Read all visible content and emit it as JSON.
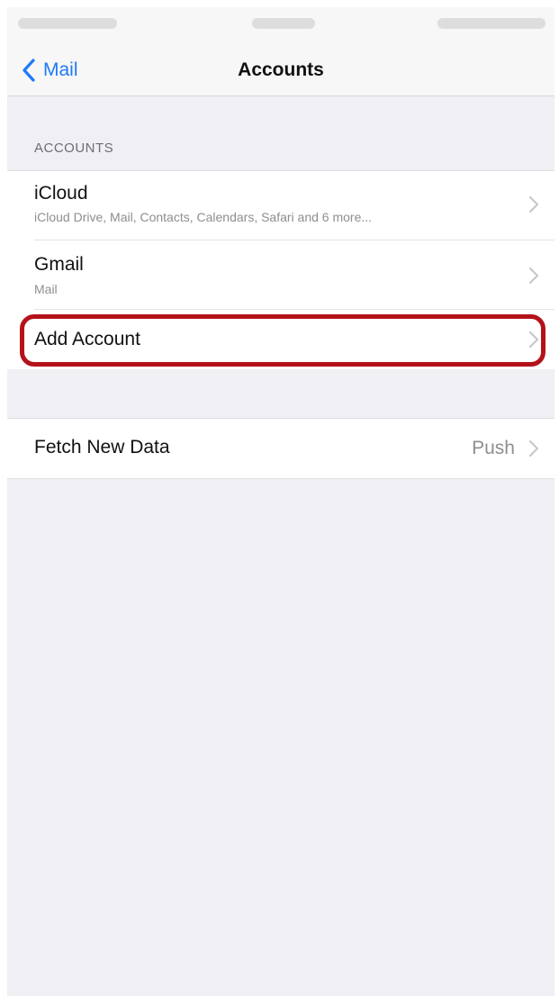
{
  "nav": {
    "back_label": "Mail",
    "title": "Accounts"
  },
  "accounts_section": {
    "header": "ACCOUNTS",
    "rows": [
      {
        "title": "iCloud",
        "subtitle": "iCloud Drive, Mail, Contacts, Calendars, Safari and 6 more..."
      },
      {
        "title": "Gmail",
        "subtitle": "Mail"
      },
      {
        "title": "Add Account"
      }
    ]
  },
  "fetch_section": {
    "title": "Fetch New Data",
    "value": "Push"
  },
  "icons": {
    "back": "chevron-left-icon",
    "disclosure": "chevron-right-icon"
  },
  "colors": {
    "accent": "#1e7af6",
    "highlight": "#b4121b",
    "background": "#efeff4"
  }
}
